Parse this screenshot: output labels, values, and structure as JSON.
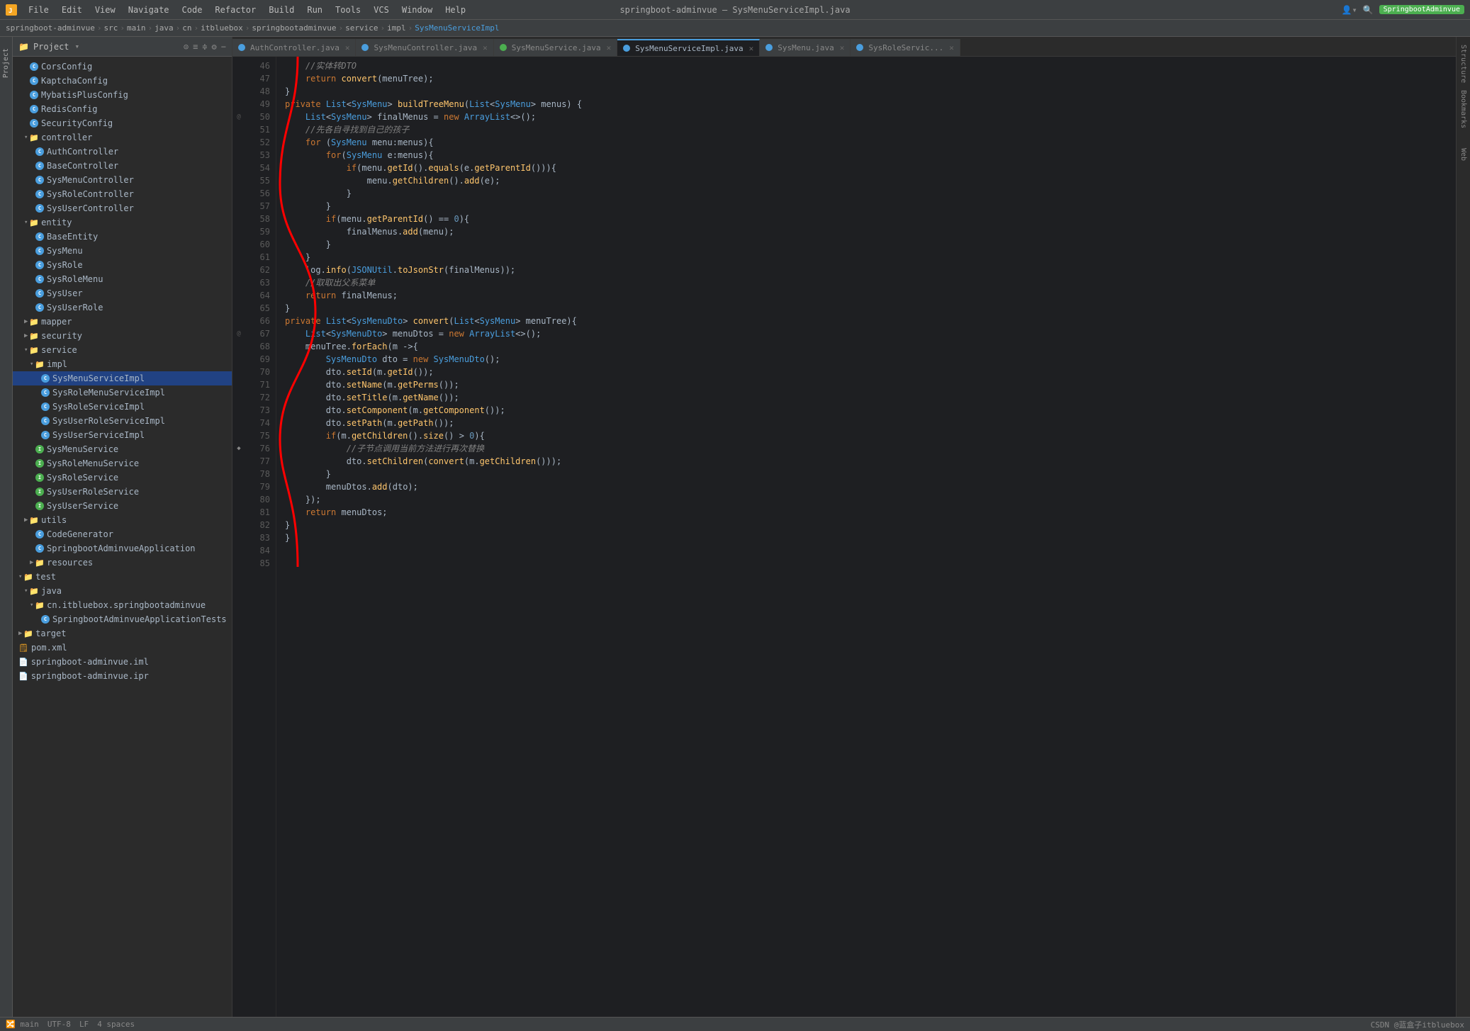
{
  "titleBar": {
    "appIcon": "▶",
    "menuItems": [
      "File",
      "Edit",
      "View",
      "Navigate",
      "Code",
      "Refactor",
      "Build",
      "Run",
      "Tools",
      "VCS",
      "Window",
      "Help"
    ],
    "projectTitle": "springboot-adminvue – SysMenuServiceImpl.java",
    "rightLabel": "SpringbootAdminvue"
  },
  "breadcrumb": {
    "parts": [
      "springboot-adminvue",
      "src",
      "main",
      "java",
      "cn",
      "itbluebox",
      "springbootadminvue",
      "service",
      "impl",
      "SysMenuServiceImpl"
    ]
  },
  "panel": {
    "title": "Project",
    "dropdownLabel": "▾"
  },
  "fileTree": [
    {
      "id": "corsconfig",
      "label": "CorsConfig",
      "indent": 24,
      "type": "ci-blue",
      "depth": 3
    },
    {
      "id": "kaptchaconfig",
      "label": "KaptchaConfig",
      "indent": 24,
      "type": "ci-blue",
      "depth": 3
    },
    {
      "id": "mybatisplusconfig",
      "label": "MybatisPlusConfig",
      "indent": 24,
      "type": "ci-blue",
      "depth": 3
    },
    {
      "id": "redisconfig",
      "label": "RedisConfig",
      "indent": 24,
      "type": "ci-blue",
      "depth": 3
    },
    {
      "id": "securityconfig",
      "label": "SecurityConfig",
      "indent": 24,
      "type": "ci-blue",
      "depth": 3
    },
    {
      "id": "controller",
      "label": "controller",
      "indent": 16,
      "type": "folder",
      "depth": 2,
      "expanded": true
    },
    {
      "id": "authcontroller",
      "label": "AuthController",
      "indent": 32,
      "type": "ci-blue",
      "depth": 4
    },
    {
      "id": "basecontroller",
      "label": "BaseController",
      "indent": 32,
      "type": "ci-blue",
      "depth": 4
    },
    {
      "id": "sysmenucontroller",
      "label": "SysMenuController",
      "indent": 32,
      "type": "ci-blue",
      "depth": 4
    },
    {
      "id": "sysrolecontroller",
      "label": "SysRoleController",
      "indent": 32,
      "type": "ci-blue",
      "depth": 4
    },
    {
      "id": "sysusercontroller",
      "label": "SysUserController",
      "indent": 32,
      "type": "ci-blue",
      "depth": 4
    },
    {
      "id": "entity",
      "label": "entity",
      "indent": 16,
      "type": "folder",
      "depth": 2,
      "expanded": true
    },
    {
      "id": "baseentity",
      "label": "BaseEntity",
      "indent": 32,
      "type": "ci-blue",
      "depth": 4
    },
    {
      "id": "sysmenu",
      "label": "SysMenu",
      "indent": 32,
      "type": "ci-blue",
      "depth": 4
    },
    {
      "id": "sysrole",
      "label": "SysRole",
      "indent": 32,
      "type": "ci-blue",
      "depth": 4
    },
    {
      "id": "sysrolemenu",
      "label": "SysRoleMenu",
      "indent": 32,
      "type": "ci-blue",
      "depth": 4
    },
    {
      "id": "sysuser",
      "label": "SysUser",
      "indent": 32,
      "type": "ci-blue",
      "depth": 4
    },
    {
      "id": "sysuserrole",
      "label": "SysUserRole",
      "indent": 32,
      "type": "ci-blue",
      "depth": 4
    },
    {
      "id": "mapper",
      "label": "mapper",
      "indent": 16,
      "type": "folder-collapsed",
      "depth": 2
    },
    {
      "id": "security",
      "label": "security",
      "indent": 16,
      "type": "folder-collapsed",
      "depth": 2
    },
    {
      "id": "service",
      "label": "service",
      "indent": 16,
      "type": "folder",
      "depth": 2,
      "expanded": true
    },
    {
      "id": "impl",
      "label": "impl",
      "indent": 24,
      "type": "folder",
      "depth": 3,
      "expanded": true
    },
    {
      "id": "sysmenuserviceimpl",
      "label": "SysMenuServiceImpl",
      "indent": 40,
      "type": "ci-blue",
      "depth": 5,
      "selected": true
    },
    {
      "id": "sysrolemenuserviceimpl",
      "label": "SysRoleMenuServiceImpl",
      "indent": 40,
      "type": "ci-blue",
      "depth": 5
    },
    {
      "id": "sysroleserviceimpl",
      "label": "SysRoleServiceImpl",
      "indent": 40,
      "type": "ci-blue",
      "depth": 5
    },
    {
      "id": "sysuserroleserviceimpl",
      "label": "SysUserRoleServiceImpl",
      "indent": 40,
      "type": "ci-blue",
      "depth": 5
    },
    {
      "id": "sysuserserviceimpl",
      "label": "SysUserServiceImpl",
      "indent": 40,
      "type": "ci-blue",
      "depth": 5
    },
    {
      "id": "sysmenuservice",
      "label": "SysMenuService",
      "indent": 32,
      "type": "ci-green",
      "depth": 4
    },
    {
      "id": "sysrolemenuservice",
      "label": "SysRoleMenuService",
      "indent": 32,
      "type": "ci-green",
      "depth": 4
    },
    {
      "id": "sysroleservice",
      "label": "SysRoleService",
      "indent": 32,
      "type": "ci-green",
      "depth": 4
    },
    {
      "id": "sysuserroleservice",
      "label": "SysUserRoleService",
      "indent": 32,
      "type": "ci-green",
      "depth": 4
    },
    {
      "id": "sysuserservice",
      "label": "SysUserService",
      "indent": 32,
      "type": "ci-green",
      "depth": 4
    },
    {
      "id": "utils",
      "label": "utils",
      "indent": 16,
      "type": "folder-collapsed",
      "depth": 2
    },
    {
      "id": "codegenerator",
      "label": "CodeGenerator",
      "indent": 32,
      "type": "ci-blue",
      "depth": 4
    },
    {
      "id": "springbootadminvueapp",
      "label": "SpringbootAdminvueApplication",
      "indent": 32,
      "type": "ci-blue",
      "depth": 4
    },
    {
      "id": "resources",
      "label": "resources",
      "indent": 24,
      "type": "folder-collapsed",
      "depth": 3
    },
    {
      "id": "test",
      "label": "test",
      "indent": 8,
      "type": "folder",
      "depth": 1,
      "expanded": true
    },
    {
      "id": "java2",
      "label": "java",
      "indent": 16,
      "type": "folder-blue",
      "depth": 2,
      "expanded": true
    },
    {
      "id": "cn2",
      "label": "cn.itbluebox.springbootadminvue",
      "indent": 24,
      "type": "folder-blue",
      "depth": 3,
      "expanded": true
    },
    {
      "id": "springbootadminvuetests",
      "label": "SpringbootAdminvueApplicationTests",
      "indent": 40,
      "type": "ci-blue",
      "depth": 5
    },
    {
      "id": "target",
      "label": "target",
      "indent": 8,
      "type": "folder-collapsed",
      "depth": 1
    },
    {
      "id": "pomxml",
      "label": "pom.xml",
      "indent": 8,
      "type": "xml",
      "depth": 1
    },
    {
      "id": "springbootiml",
      "label": "springboot-adminvue.iml",
      "indent": 8,
      "type": "iml",
      "depth": 1
    },
    {
      "id": "springbootipr",
      "label": "springboot-adminvue.ipr",
      "indent": 8,
      "type": "ipr",
      "depth": 1
    }
  ],
  "tabs": [
    {
      "id": "authcontroller",
      "label": "AuthController.java",
      "active": false,
      "color": "#4a9ede"
    },
    {
      "id": "sysmenucontroller",
      "label": "SysMenuController.java",
      "active": false,
      "color": "#4a9ede"
    },
    {
      "id": "sysmenuservice",
      "label": "SysMenuService.java",
      "active": false,
      "color": "#4caf50"
    },
    {
      "id": "sysmenuserviceimpl",
      "label": "SysMenuServiceImpl.java",
      "active": true,
      "color": "#4a9ede"
    },
    {
      "id": "sysmenu",
      "label": "SysMenu.java",
      "active": false,
      "color": "#4a9ede"
    },
    {
      "id": "sysroleservic",
      "label": "SysRoleServic...",
      "active": false,
      "color": "#4a9ede"
    }
  ],
  "codeLines": [
    {
      "num": 46,
      "gutter": "",
      "code": "    <span class='comment'>//实体转DTO</span>"
    },
    {
      "num": 47,
      "gutter": "",
      "code": "    <span class='kw'>return</span> <span class='fn'>convert</span>(menuTree);"
    },
    {
      "num": 48,
      "gutter": "",
      "code": "}"
    },
    {
      "num": 49,
      "gutter": "",
      "code": ""
    },
    {
      "num": 50,
      "gutter": "@",
      "code": "<span class='kw'>private</span> <span class='type2'>List</span>&lt;<span class='type2'>SysMenu</span>&gt; <span class='fn'>buildTreeMenu</span>(<span class='type2'>List</span>&lt;<span class='type2'>SysMenu</span>&gt; menus) {"
    },
    {
      "num": 51,
      "gutter": "",
      "code": "    <span class='type2'>List</span>&lt;<span class='type2'>SysMenu</span>&gt; finalMenus = <span class='kw'>new</span> <span class='type2'>ArrayList</span>&lt;&gt;();"
    },
    {
      "num": 52,
      "gutter": "",
      "code": "    <span class='comment'>//先各自寻找到自己的孩子</span>"
    },
    {
      "num": 53,
      "gutter": "",
      "code": "    <span class='kw'>for</span> (<span class='type2'>SysMenu</span> menu:menus){"
    },
    {
      "num": 54,
      "gutter": "",
      "code": "        <span class='kw'>for</span>(<span class='type2'>SysMenu</span> e:menus){"
    },
    {
      "num": 55,
      "gutter": "",
      "code": "            <span class='kw'>if</span>(menu.<span class='fn'>getId</span>().<span class='fn'>equals</span>(e.<span class='fn'>getParentId</span>())){"
    },
    {
      "num": 56,
      "gutter": "",
      "code": "                menu.<span class='fn'>getChildren</span>().<span class='fn'>add</span>(e);"
    },
    {
      "num": 57,
      "gutter": "",
      "code": "            }"
    },
    {
      "num": 58,
      "gutter": "",
      "code": "        }"
    },
    {
      "num": 59,
      "gutter": "",
      "code": "        <span class='kw'>if</span>(menu.<span class='fn'>getParentId</span>() == <span class='num'>0</span>){"
    },
    {
      "num": 60,
      "gutter": "",
      "code": "            finalMenus.<span class='fn'>add</span>(menu);"
    },
    {
      "num": 61,
      "gutter": "",
      "code": "        }"
    },
    {
      "num": 62,
      "gutter": "",
      "code": "    }"
    },
    {
      "num": 63,
      "gutter": "",
      "code": "    log.<span class='fn'>info</span>(<span class='type2'>JSONUtil</span>.<span class='fn'>toJsonStr</span>(finalMenus));"
    },
    {
      "num": 64,
      "gutter": "",
      "code": "    <span class='comment'>//取取出父系菜单</span>"
    },
    {
      "num": 65,
      "gutter": "",
      "code": "    <span class='kw'>return</span> finalMenus;"
    },
    {
      "num": 66,
      "gutter": "",
      "code": "}"
    },
    {
      "num": 67,
      "gutter": "@",
      "code": "<span class='kw'>private</span> <span class='type2'>List</span>&lt;<span class='type2'>SysMenuDto</span>&gt; <span class='fn'>convert</span>(<span class='type2'>List</span>&lt;<span class='type2'>SysMenu</span>&gt; menuTree){"
    },
    {
      "num": 68,
      "gutter": "",
      "code": "    <span class='type2'>List</span>&lt;<span class='type2'>SysMenuDto</span>&gt; menuDtos = <span class='kw'>new</span> <span class='type2'>ArrayList</span>&lt;&gt;();"
    },
    {
      "num": 69,
      "gutter": "",
      "code": "    menuTree.<span class='fn'>forEach</span>(m -&gt;{"
    },
    {
      "num": 70,
      "gutter": "",
      "code": "        <span class='type2'>SysMenuDto</span> dto = <span class='kw'>new</span> <span class='type2'>SysMenuDto</span>();"
    },
    {
      "num": 71,
      "gutter": "",
      "code": "        dto.<span class='fn'>setId</span>(m.<span class='fn'>getId</span>());"
    },
    {
      "num": 72,
      "gutter": "",
      "code": "        dto.<span class='fn'>setName</span>(m.<span class='fn'>getPerms</span>());"
    },
    {
      "num": 73,
      "gutter": "",
      "code": "        dto.<span class='fn'>setTitle</span>(m.<span class='fn'>getName</span>());"
    },
    {
      "num": 74,
      "gutter": "",
      "code": "        dto.<span class='fn'>setComponent</span>(m.<span class='fn'>getComponent</span>());"
    },
    {
      "num": 75,
      "gutter": "",
      "code": "        dto.<span class='fn'>setPath</span>(m.<span class='fn'>getPath</span>());"
    },
    {
      "num": 76,
      "gutter": "♦",
      "code": "        <span class='kw'>if</span>(m.<span class='fn'>getChildren</span>().<span class='fn'>size</span>() &gt; <span class='num'>0</span>){"
    },
    {
      "num": 77,
      "gutter": "",
      "code": "            <span class='comment'>//子节点调用当前方法进行再次替换</span>"
    },
    {
      "num": 78,
      "gutter": "",
      "code": "            dto.<span class='fn'>setChildren</span>(<span class='fn'>convert</span>(m.<span class='fn'>getChildren</span>()));"
    },
    {
      "num": 79,
      "gutter": "",
      "code": "        }"
    },
    {
      "num": 80,
      "gutter": "",
      "code": "        menuDtos.<span class='fn'>add</span>(dto);"
    },
    {
      "num": 81,
      "gutter": "",
      "code": "    });"
    },
    {
      "num": 82,
      "gutter": "",
      "code": "    <span class='kw'>return</span> menuDtos;"
    },
    {
      "num": 83,
      "gutter": "",
      "code": "}"
    },
    {
      "num": 84,
      "gutter": "",
      "code": ""
    },
    {
      "num": 85,
      "gutter": "",
      "code": "}"
    }
  ],
  "statusBar": {
    "branch": "main",
    "encoding": "UTF-8",
    "lineEnding": "LF",
    "indent": "4 spaces",
    "rightLabel": "CSDN @蓝盒子itbluebox"
  },
  "verticalTabs": [
    "Structure",
    "Bookmarks",
    "Web"
  ]
}
